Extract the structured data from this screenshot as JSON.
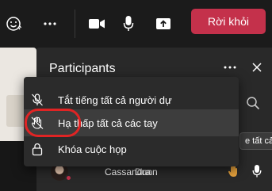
{
  "toolbar": {
    "reactions_icon": "reactions-icon",
    "more_icon": "more-options-icon",
    "camera_icon": "video-camera-icon",
    "mic_icon": "microphone-icon",
    "share_icon": "share-tray-icon",
    "leave_label": "Rời khỏi",
    "leave_color": "#c4314b"
  },
  "panel": {
    "title": "Participants",
    "mute_all_partial": "e tất cả"
  },
  "menu": {
    "items": [
      {
        "label": "Tắt tiếng tất cả người dự",
        "icon": "mic-off-icon"
      },
      {
        "label": "Hạ thấp tất cả các tay",
        "icon": "hand-off-icon",
        "selected": true
      },
      {
        "label": "Khóa cuộc họp",
        "icon": "lock-icon"
      }
    ]
  },
  "participants": [
    {
      "first": "Cassandra",
      "last": "Dunn",
      "hand_raised": true,
      "hand_color": "#e8a33d"
    }
  ],
  "colors": {
    "annotation_ring": "#e02424"
  }
}
